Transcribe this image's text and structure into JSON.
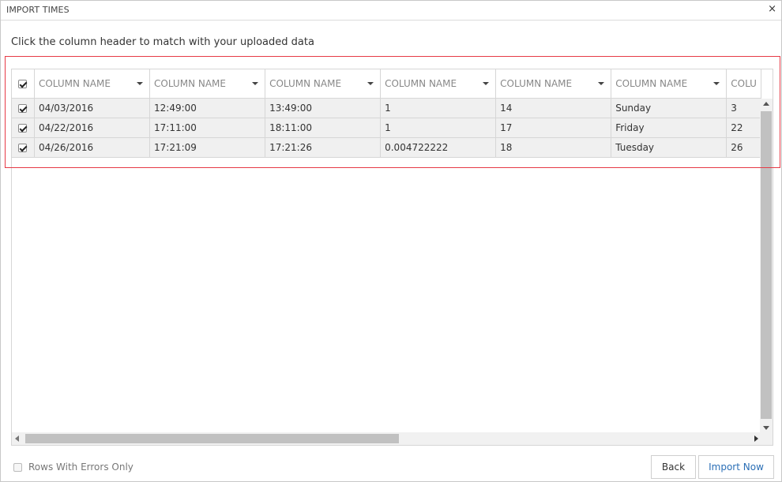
{
  "window": {
    "title": "IMPORT TIMES",
    "close_glyph": "×"
  },
  "instruction": "Click the column header to match with your uploaded data",
  "grid": {
    "columns": [
      {
        "label": "COLUMN NAME"
      },
      {
        "label": "COLUMN NAME"
      },
      {
        "label": "COLUMN NAME"
      },
      {
        "label": "COLUMN NAME"
      },
      {
        "label": "COLUMN NAME"
      },
      {
        "label": "COLUMN NAME"
      },
      {
        "label": "COLU"
      }
    ],
    "rows": [
      {
        "checked": true,
        "cells": [
          "04/03/2016",
          "12:49:00",
          "13:49:00",
          "1",
          "14",
          "Sunday",
          "3"
        ]
      },
      {
        "checked": true,
        "cells": [
          "04/22/2016",
          "17:11:00",
          "18:11:00",
          "1",
          "17",
          "Friday",
          "22"
        ]
      },
      {
        "checked": true,
        "cells": [
          "04/26/2016",
          "17:21:09",
          "17:21:26",
          "0.004722222",
          "18",
          "Tuesday",
          "26"
        ]
      }
    ]
  },
  "footer": {
    "errors_only_label": "Rows With Errors Only",
    "back_label": "Back",
    "import_label": "Import Now"
  },
  "colors": {
    "highlight": "#e63a46",
    "primary_text": "#2b6fb6"
  }
}
